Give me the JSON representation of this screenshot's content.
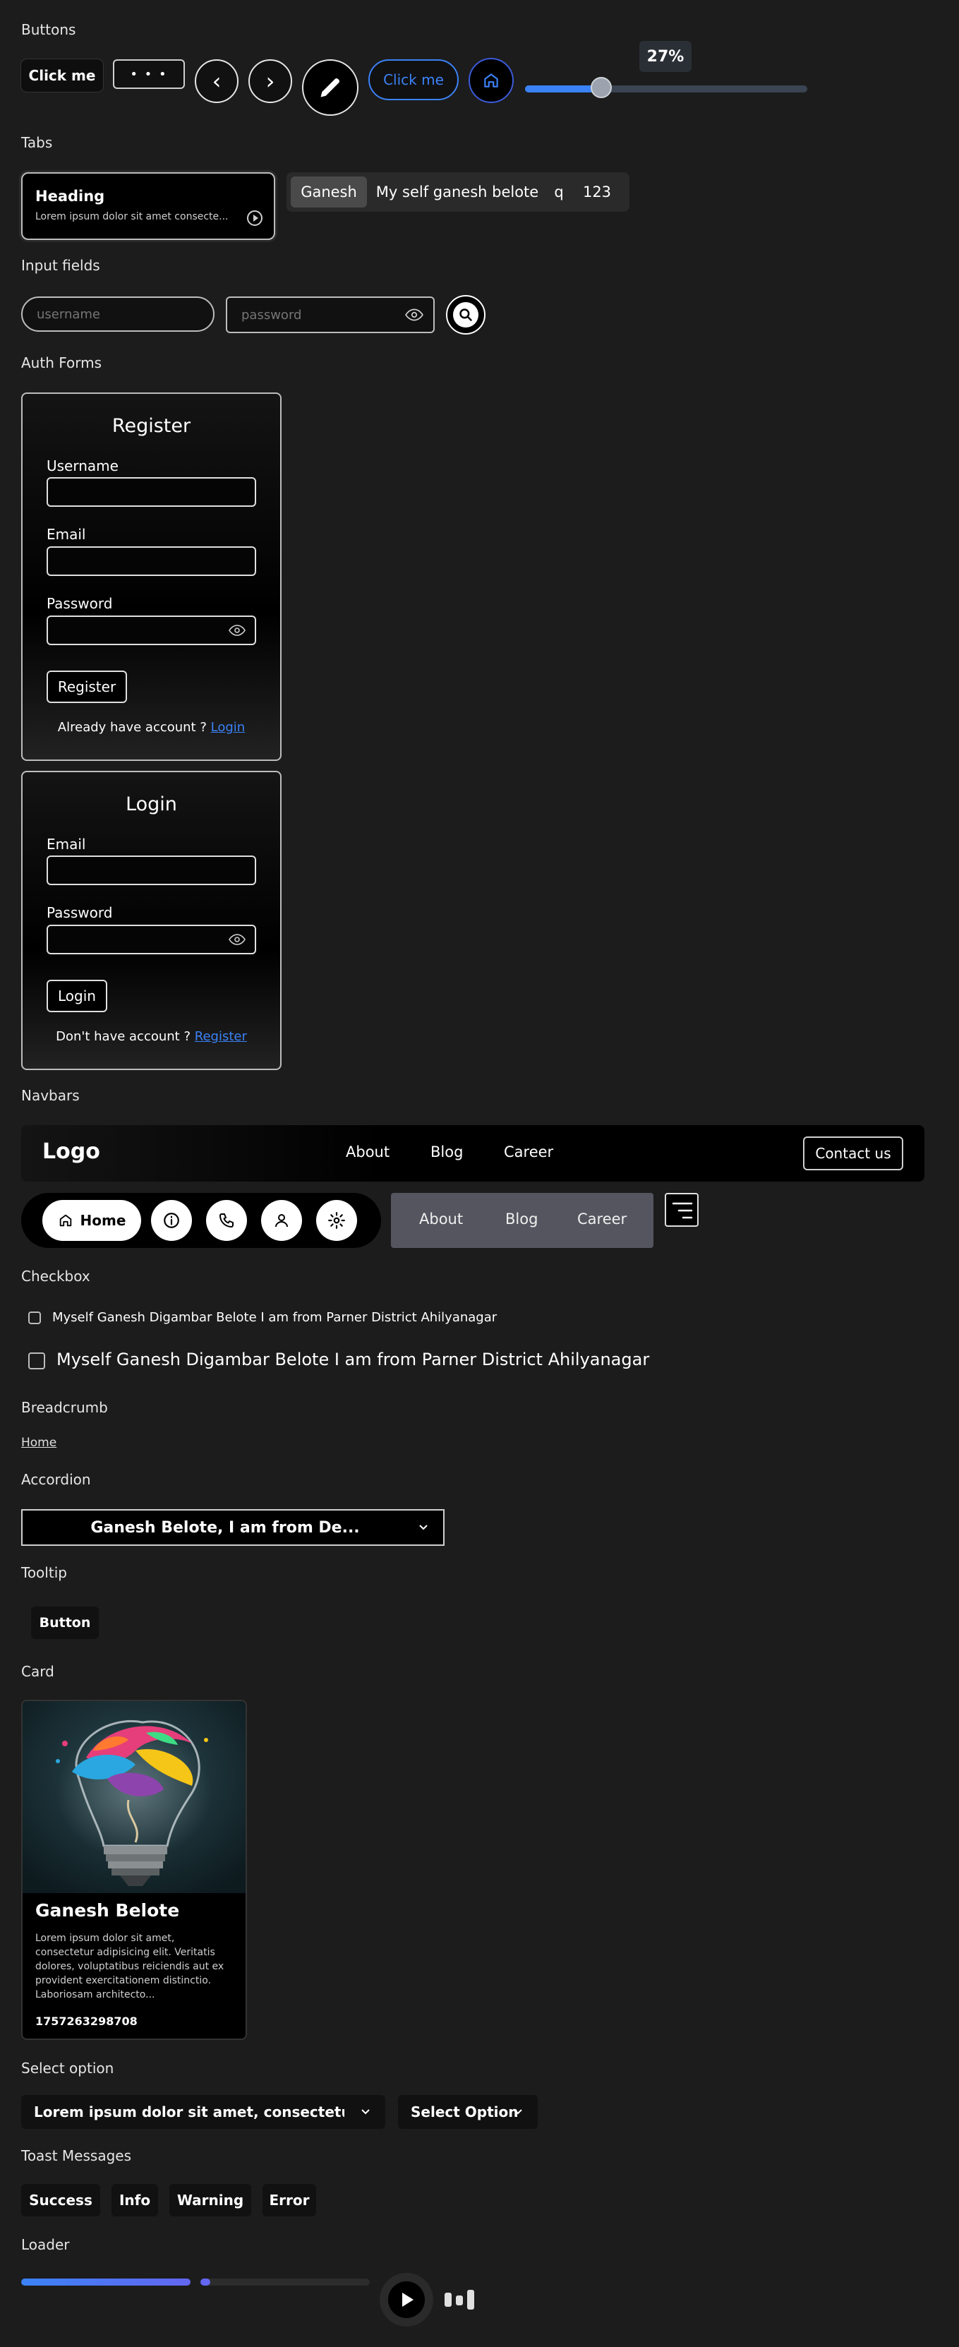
{
  "sections": {
    "buttons": "Buttons",
    "tabs": "Tabs",
    "inputs": "Input fields",
    "auth": "Auth Forms",
    "navbars": "Navbars",
    "checkbox": "Checkbox",
    "breadcrumb": "Breadcrumb",
    "accordion": "Accordion",
    "tooltip": "Tooltip",
    "card": "Card",
    "select": "Select option",
    "toast": "Toast Messages",
    "loader": "Loader"
  },
  "buttons_row": {
    "click_me": "Click me",
    "more": "• • •",
    "prev": "‹",
    "next": "›",
    "outline_click_me": "Click me",
    "slider_tooltip": "27%",
    "slider_value": 27
  },
  "tabs": {
    "card_heading": "Heading",
    "card_text": "Lorem ipsum dolor sit amet consecte...",
    "items": [
      "Ganesh",
      "My self ganesh belote",
      "q",
      "123"
    ]
  },
  "inputs": {
    "username_placeholder": "username",
    "password_placeholder": "password"
  },
  "register": {
    "title": "Register",
    "username_label": "Username",
    "email_label": "Email",
    "password_label": "Password",
    "button": "Register",
    "footer_text": "Already have account ?",
    "footer_link": "Login"
  },
  "login": {
    "title": "Login",
    "email_label": "Email",
    "password_label": "Password",
    "button": "Login",
    "footer_text": "Don't have account ?",
    "footer_link": "Register"
  },
  "navbar1": {
    "logo": "Logo",
    "links": [
      "About",
      "Blog",
      "Career"
    ],
    "cta": "Contact us"
  },
  "navbar2": {
    "home": "Home",
    "links": [
      "About",
      "Blog",
      "Career"
    ]
  },
  "checkbox": {
    "small_label": "Myself Ganesh Digambar Belote I am from Parner District Ahilyanagar",
    "large_label": "Myself Ganesh Digambar Belote I am from Parner District Ahilyanagar"
  },
  "breadcrumb": {
    "home": "Home"
  },
  "accordion": {
    "title": "Ganesh Belote, I am from De..."
  },
  "tooltip": {
    "button": "Button"
  },
  "card": {
    "name": "Ganesh Belote",
    "description": "Lorem ipsum dolor sit amet, consectetur adipisicing elit. Veritatis dolores, voluptatibus reiciendis aut ex provident exercitationem distinctio. Laboriosam architecto...",
    "id": "1757263298708"
  },
  "select": {
    "first": "Lorem ipsum dolor sit amet, consectetur...",
    "second": "Select Option"
  },
  "toast": {
    "buttons": [
      "Success",
      "Info",
      "Warning",
      "Error"
    ]
  },
  "loader": {
    "bar1_progress": 1.0,
    "bar2_progress": 0.06
  },
  "colors": {
    "accent": "#3b82f6",
    "background": "#1c1c1c",
    "navbar_gray": "#55555f"
  }
}
